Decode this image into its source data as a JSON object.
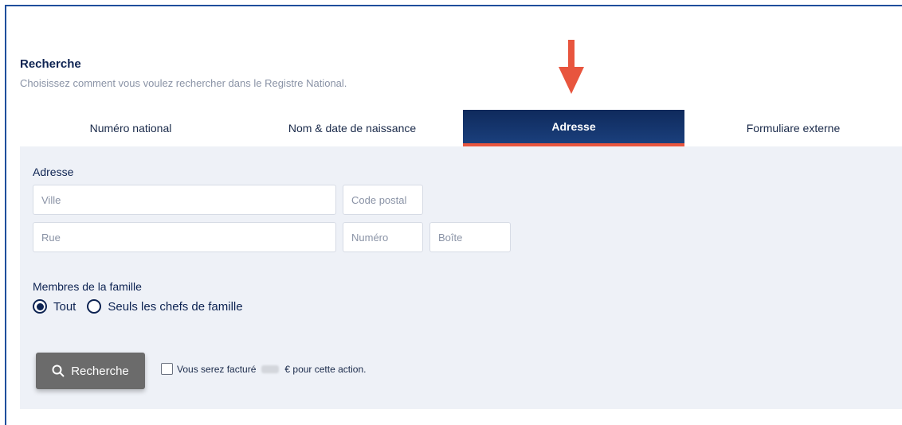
{
  "header": {
    "title": "Recherche",
    "subtitle": "Choisissez comment vous voulez rechercher dans le Registre National."
  },
  "tabs": [
    {
      "label": "Numéro national",
      "active": false
    },
    {
      "label": "Nom & date de naissance",
      "active": false
    },
    {
      "label": "Adresse",
      "active": true
    },
    {
      "label": "Formuliare externe",
      "active": false
    }
  ],
  "form": {
    "address_label": "Adresse",
    "ville_placeholder": "Ville",
    "code_postal_placeholder": "Code postal",
    "rue_placeholder": "Rue",
    "numero_placeholder": "Numéro",
    "boite_placeholder": "Boîte",
    "family_label": "Membres de la famille",
    "radio_all": "Tout",
    "radio_heads": "Seuls les chefs de famille",
    "radio_selected": "Tout"
  },
  "actions": {
    "search_label": "Recherche",
    "billing_prefix": "Vous serez facturé",
    "billing_suffix": "€ pour cette action."
  },
  "colors": {
    "accent_arrow": "#e8553e",
    "active_tab": "#0f2a5c",
    "button": "#6b6b6b"
  },
  "icons": {
    "annotation": "down-arrow-icon",
    "search": "magnifier-icon"
  }
}
